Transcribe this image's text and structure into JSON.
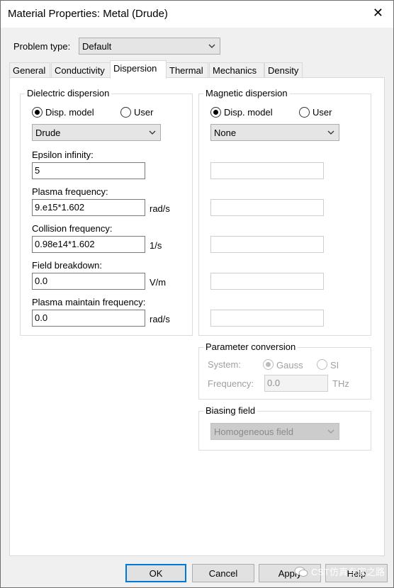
{
  "window": {
    "title": "Material Properties: Metal (Drude)",
    "close_glyph": "✕"
  },
  "problem_type": {
    "label": "Problem type:",
    "value": "Default"
  },
  "tabs": [
    {
      "label": "General"
    },
    {
      "label": "Conductivity"
    },
    {
      "label": "Dispersion"
    },
    {
      "label": "Thermal"
    },
    {
      "label": "Mechanics"
    },
    {
      "label": "Density"
    }
  ],
  "active_tab": "Dispersion",
  "dielectric": {
    "title": "Dielectric dispersion",
    "radio_disp": "Disp. model",
    "radio_user": "User",
    "model": "Drude",
    "fields": [
      {
        "label": "Epsilon infinity:",
        "value": "5",
        "unit": ""
      },
      {
        "label": "Plasma frequency:",
        "value": "9.e15*1.602",
        "unit": "rad/s"
      },
      {
        "label": "Collision frequency:",
        "value": "0.98e14*1.602",
        "unit": "1/s"
      },
      {
        "label": "Field breakdown:",
        "value": "0.0",
        "unit": "V/m"
      },
      {
        "label": "Plasma maintain frequency:",
        "value": "0.0",
        "unit": "rad/s"
      }
    ]
  },
  "magnetic": {
    "title": "Magnetic dispersion",
    "radio_disp": "Disp. model",
    "radio_user": "User",
    "model": "None"
  },
  "param_conversion": {
    "title": "Parameter conversion",
    "system_label": "System:",
    "gauss": "Gauss",
    "si": "SI",
    "frequency_label": "Frequency:",
    "frequency_value": "0.0",
    "frequency_unit": "THz"
  },
  "biasing": {
    "title": "Biasing field",
    "value": "Homogeneous field"
  },
  "buttons": {
    "ok": "OK",
    "cancel": "Cancel",
    "apply": "Apply",
    "help": "Help"
  },
  "watermark": "CST仿真专家之路",
  "colors": {
    "accent": "#0078d7",
    "panel": "#ffffff",
    "window": "#f0f0f0"
  }
}
